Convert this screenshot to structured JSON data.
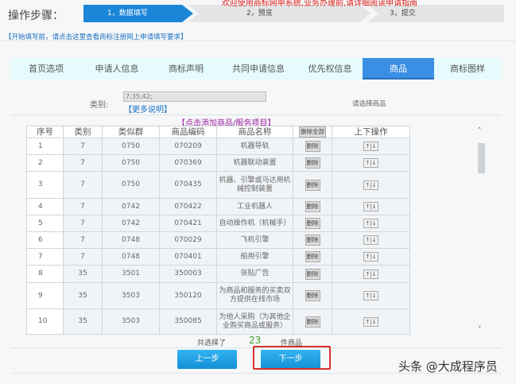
{
  "header": {
    "steps_label": "操作步骤：",
    "welcome": "欢迎使用商标网申系统,业务办理前,请详细阅读申请指南",
    "steps": [
      "1，数据填写",
      "2，预览",
      "3，提交"
    ],
    "guide_link": "【开始填写前，请点击这里查看商标注册网上申请填写要求】"
  },
  "tabs": [
    {
      "label": "首页选项",
      "active": false
    },
    {
      "label": "申请人信息",
      "active": false
    },
    {
      "label": "商标声明",
      "active": false
    },
    {
      "label": "共同申请信息",
      "active": false
    },
    {
      "label": "优先权信息",
      "active": false
    },
    {
      "label": "商品",
      "active": true
    },
    {
      "label": "商标图样",
      "active": false
    }
  ],
  "form": {
    "category_label": "类别:",
    "category_value": "7;35;42;",
    "more_link": "【更多说明】",
    "choose_hint": "请选择商品",
    "add_link": "【点击添加商品/服务项目】"
  },
  "table": {
    "headers": [
      "序号",
      "类别",
      "类似群",
      "商品编码",
      "商品名称",
      "删除全部",
      "上下操作"
    ],
    "delete_label": "删除",
    "updown_label": "↑|↓",
    "rows": [
      [
        "1",
        "7",
        "0750",
        "070209",
        "机器导轨"
      ],
      [
        "2",
        "7",
        "0750",
        "070369",
        "机器联动装置"
      ],
      [
        "3",
        "7",
        "0750",
        "070435",
        "机器、引擎或马达用机械控制装置"
      ],
      [
        "4",
        "7",
        "0742",
        "070422",
        "工业机器人"
      ],
      [
        "5",
        "7",
        "0742",
        "070421",
        "自动操作机（机械手）"
      ],
      [
        "6",
        "7",
        "0748",
        "070029",
        "飞机引擎"
      ],
      [
        "7",
        "7",
        "0748",
        "070401",
        "船用引擎"
      ],
      [
        "8",
        "35",
        "3501",
        "350003",
        "张贴广告"
      ],
      [
        "9",
        "35",
        "3503",
        "350120",
        "为商品和服务的买卖双方提供在线市场"
      ],
      [
        "10",
        "35",
        "3503",
        "350085",
        "为他人采购（为其他企业购买商品或服务）"
      ]
    ]
  },
  "footer": {
    "selected_prefix": "共选择了",
    "selected_count": "23",
    "selected_suffix": "件商品",
    "prev_label": "上一步",
    "next_label": "下一步",
    "watermark": "头条 @大成程序员"
  }
}
